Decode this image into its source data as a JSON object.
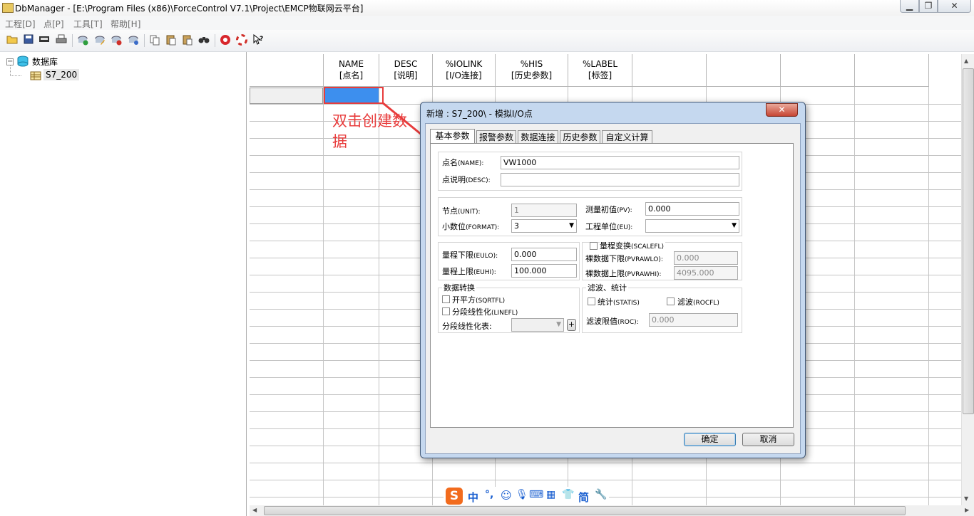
{
  "window": {
    "title": "DbManager - [E:\\Program Files (x86)\\ForceControl V7.1\\Project\\EMCP物联网云平台]",
    "minimize": "▁",
    "maximize": "❐",
    "close": "✕"
  },
  "menu": [
    "工程[D]",
    "点[P]",
    "工具[T]",
    "帮助[H]"
  ],
  "tree": {
    "root": "数据库",
    "child": "S7_200",
    "expander": "−"
  },
  "grid": {
    "columns": [
      {
        "line1": "NAME",
        "line2": "[点名]"
      },
      {
        "line1": "DESC",
        "line2": "[说明]"
      },
      {
        "line1": "%IOLINK",
        "line2": "[I/O连接]"
      },
      {
        "line1": "%HIS",
        "line2": "[历史参数]"
      },
      {
        "line1": "%LABEL",
        "line2": "[标签]"
      },
      {
        "line1": "",
        "line2": ""
      },
      {
        "line1": "",
        "line2": ""
      },
      {
        "line1": "",
        "line2": ""
      },
      {
        "line1": "",
        "line2": ""
      }
    ]
  },
  "annotation": {
    "text": "双击创建数据"
  },
  "dialog": {
    "title": "新增 : S7_200\\ - 模拟I/O点",
    "close": "✕",
    "tabs": [
      "基本参数",
      "报警参数",
      "数据连接",
      "历史参数",
      "自定义计算"
    ],
    "name_label": "点名",
    "name_tag": "(NAME):",
    "name_value": "VW1000",
    "desc_label": "点说明",
    "desc_tag": "(DESC):",
    "desc_value": "",
    "unit_label": "节点",
    "unit_tag": "(UNIT):",
    "unit_value": "1",
    "format_label": "小数位",
    "format_tag": "(FORMAT):",
    "format_value": "3",
    "pv_label": "测量初值",
    "pv_tag": "(PV):",
    "pv_value": "0.000",
    "eu_label": "工程单位",
    "eu_tag": "(EU):",
    "eu_value": "",
    "eulo_label": "量程下限",
    "eulo_tag": "(EULO):",
    "eulo_value": "0.000",
    "euhi_label": "量程上限",
    "euhi_tag": "(EUHI):",
    "euhi_value": "100.000",
    "scalefl_label": "量程变换",
    "scalefl_tag": "(SCALEFL)",
    "pvrawlo_label": "裸数据下限",
    "pvrawlo_tag": "(PVRAWLO):",
    "pvrawlo_value": "0.000",
    "pvrawhi_label": "裸数据上限",
    "pvrawhi_tag": "(PVRAWHI):",
    "pvrawhi_value": "4095.000",
    "conv_group": "数据转换",
    "sqrt_label": "开平方",
    "sqrt_tag": "(SQRTFL)",
    "linefl_label": "分段线性化",
    "linefl_tag": "(LINEFL)",
    "linetab_label": "分段线性化表:",
    "linetab_value": "",
    "add_btn": "+",
    "filter_group": "滤波、统计",
    "statis_label": "统计",
    "statis_tag": "(STATIS)",
    "rocfl_label": "滤波",
    "rocfl_tag": "(ROCFL)",
    "roc_label": "滤波限值",
    "roc_tag": "(ROC):",
    "roc_value": "0.000",
    "ok": "确定",
    "cancel": "取消"
  },
  "ime": {
    "logo": "S",
    "mode": "中",
    "punct": "°,",
    "simp": "简"
  }
}
